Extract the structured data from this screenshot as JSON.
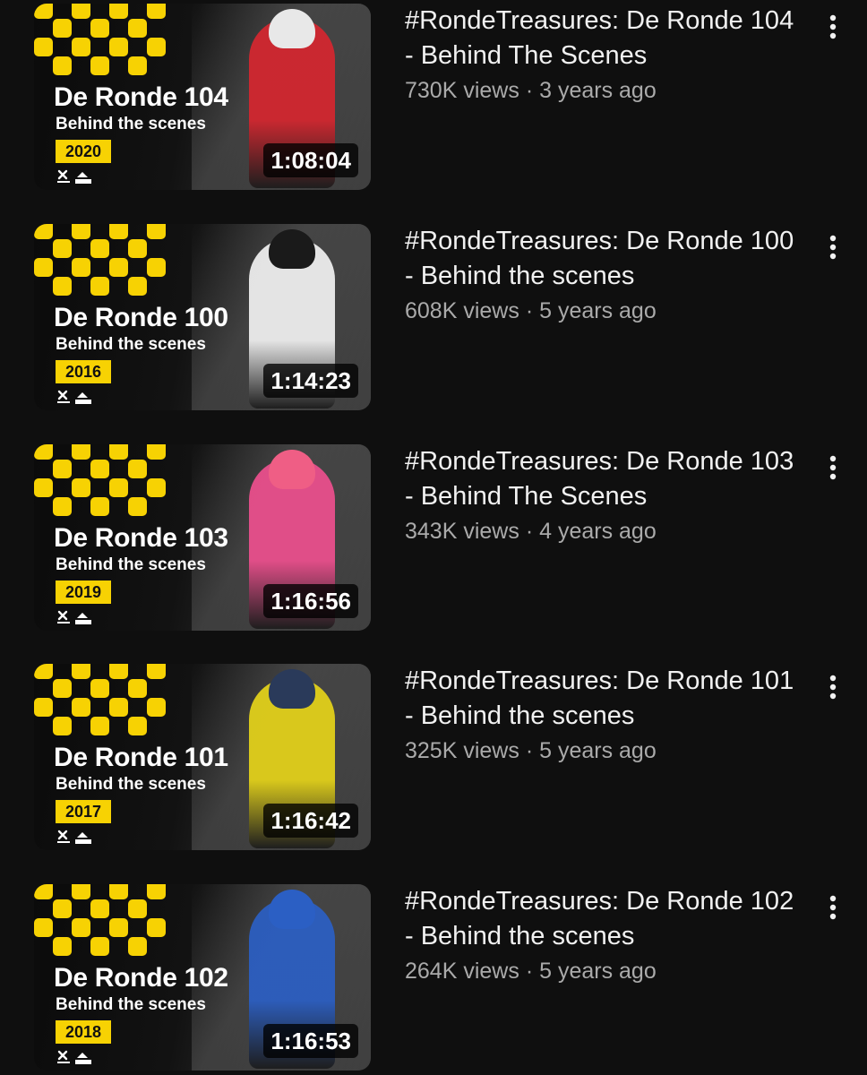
{
  "videos": [
    {
      "title": "#RondeTreasures: De Ronde 104 - Behind The Scenes",
      "views": "730K views",
      "separator": "·",
      "age": "3 years ago",
      "duration": "1:08:04",
      "thumb": {
        "heading": "De Ronde 104",
        "subheading": "Behind the scenes",
        "year": "2020"
      },
      "rider_colors": {
        "jersey": "#d6262f",
        "helmet": "#e8e8e8"
      }
    },
    {
      "title": "#RondeTreasures: De Ronde 100 - Behind the scenes",
      "views": "608K views",
      "separator": "·",
      "age": "5 years ago",
      "duration": "1:14:23",
      "thumb": {
        "heading": "De Ronde 100",
        "subheading": "Behind the scenes",
        "year": "2016"
      },
      "rider_colors": {
        "jersey": "#f2f2f2",
        "helmet": "#1a1a1a"
      }
    },
    {
      "title": "#RondeTreasures: De Ronde 103 - Behind The Scenes",
      "views": "343K views",
      "separator": "·",
      "age": "4 years ago",
      "duration": "1:16:56",
      "thumb": {
        "heading": "De Ronde 103",
        "subheading": "Behind the scenes",
        "year": "2019"
      },
      "rider_colors": {
        "jersey": "#ee4f8e",
        "helmet": "#ef5e85"
      }
    },
    {
      "title": "#RondeTreasures: De Ronde 101 - Behind the scenes",
      "views": "325K views",
      "separator": "·",
      "age": "5 years ago",
      "duration": "1:16:42",
      "thumb": {
        "heading": "De Ronde 101",
        "subheading": "Behind the scenes",
        "year": "2017"
      },
      "rider_colors": {
        "jersey": "#e6d419",
        "helmet": "#2a3a5a"
      }
    },
    {
      "title": "#RondeTreasures: De Ronde 102 - Behind the scenes",
      "views": "264K views",
      "separator": "·",
      "age": "5 years ago",
      "duration": "1:16:53",
      "thumb": {
        "heading": "De Ronde 102",
        "subheading": "Behind the scenes",
        "year": "2018"
      },
      "rider_colors": {
        "jersey": "#2b5fc4",
        "helmet": "#2b5fc4"
      }
    }
  ],
  "colors": {
    "background": "#0f0f0f",
    "checker_yellow": "#f7d203",
    "title_text": "#f1f1f1",
    "secondary_text": "#aaaaaa"
  },
  "icons": {
    "more": "more-vertical-icon",
    "sponsor": "sponsor-logos-icon"
  }
}
